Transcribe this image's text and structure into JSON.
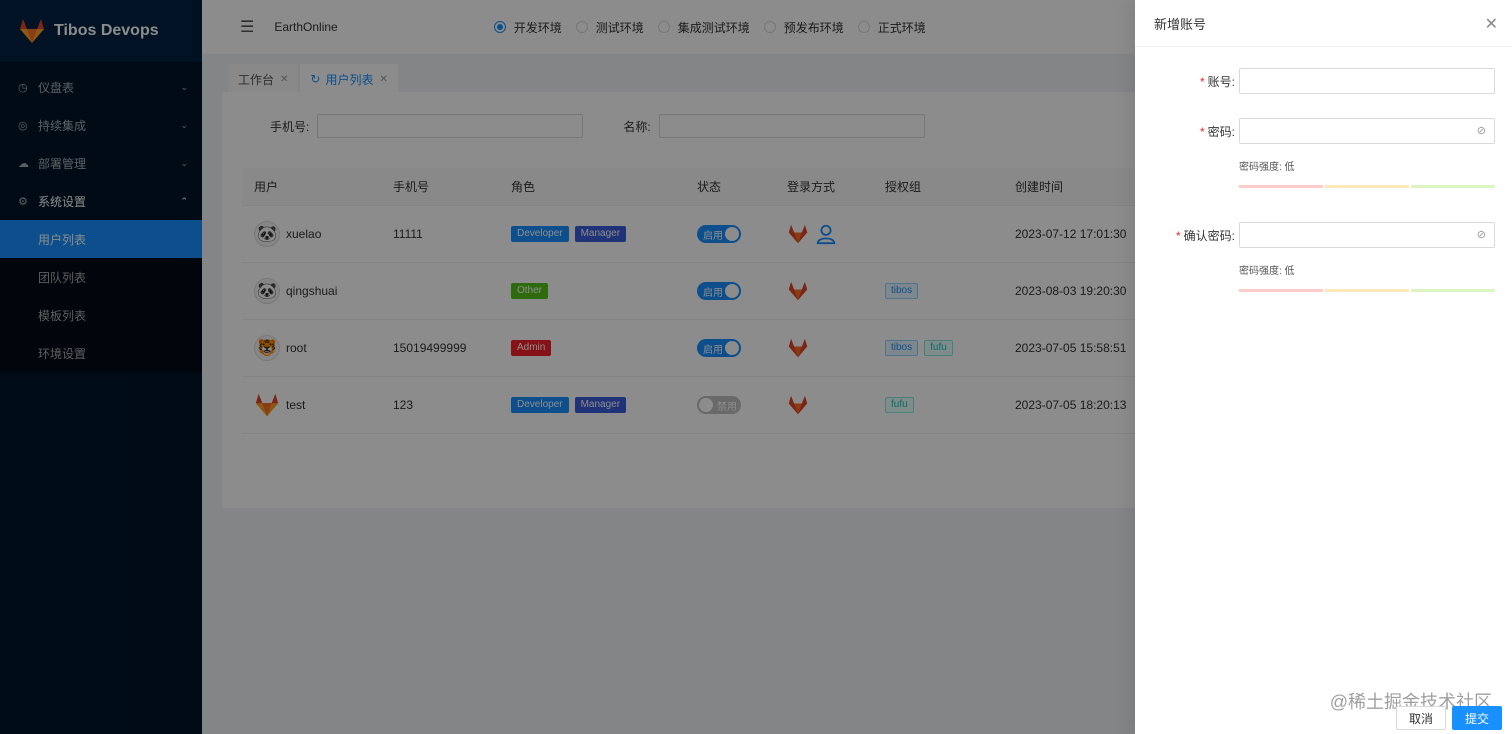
{
  "app": {
    "title": "Tibos Devops"
  },
  "sidebar": {
    "items": [
      {
        "label": "仪盘表",
        "icon": "dashboard-icon"
      },
      {
        "label": "持续集成",
        "icon": "ci-icon"
      },
      {
        "label": "部署管理",
        "icon": "cloud-icon"
      },
      {
        "label": "系统设置",
        "icon": "gear-icon"
      }
    ],
    "subitems": [
      {
        "label": "用户列表"
      },
      {
        "label": "团队列表"
      },
      {
        "label": "模板列表"
      },
      {
        "label": "环境设置"
      }
    ]
  },
  "header": {
    "project": "EarthOnline",
    "envs": [
      "开发环境",
      "测试环境",
      "集成测试环境",
      "预发布环境",
      "正式环境"
    ],
    "selected_env": "开发环境"
  },
  "tabs": [
    {
      "label": "工作台"
    },
    {
      "label": "用户列表"
    }
  ],
  "filter": {
    "phone_label": "手机号:",
    "name_label": "名称:"
  },
  "table": {
    "headers": [
      "用户",
      "手机号",
      "角色",
      "状态",
      "登录方式",
      "授权组",
      "创建时间"
    ],
    "rows": [
      {
        "user": "xuelao",
        "phone": "11111",
        "roles": [
          "Developer",
          "Manager"
        ],
        "status": "启用",
        "groups": [],
        "created": "2023-07-12 17:01:30"
      },
      {
        "user": "qingshuai",
        "phone": "",
        "roles": [
          "Other"
        ],
        "status": "启用",
        "groups": [
          "tibos"
        ],
        "created": "2023-08-03 19:20:30"
      },
      {
        "user": "root",
        "phone": "15019499999",
        "roles": [
          "Admin"
        ],
        "status": "启用",
        "groups": [
          "tibos",
          "fufu"
        ],
        "created": "2023-07-05 15:58:51"
      },
      {
        "user": "test",
        "phone": "123",
        "roles": [
          "Developer",
          "Manager"
        ],
        "status": "禁用",
        "groups": [
          "fufu"
        ],
        "created": "2023-07-05 18:20:13"
      }
    ]
  },
  "drawer": {
    "title": "新增账号",
    "account_label": "账号:",
    "password_label": "密码:",
    "confirm_label": "确认密码:",
    "strength_text": "密码强度: 低",
    "cancel": "取消",
    "submit": "提交"
  },
  "watermark": "@稀土掘金技术社区",
  "colors": {
    "primary": "#1890ff",
    "sidebar_bg": "#001529"
  }
}
